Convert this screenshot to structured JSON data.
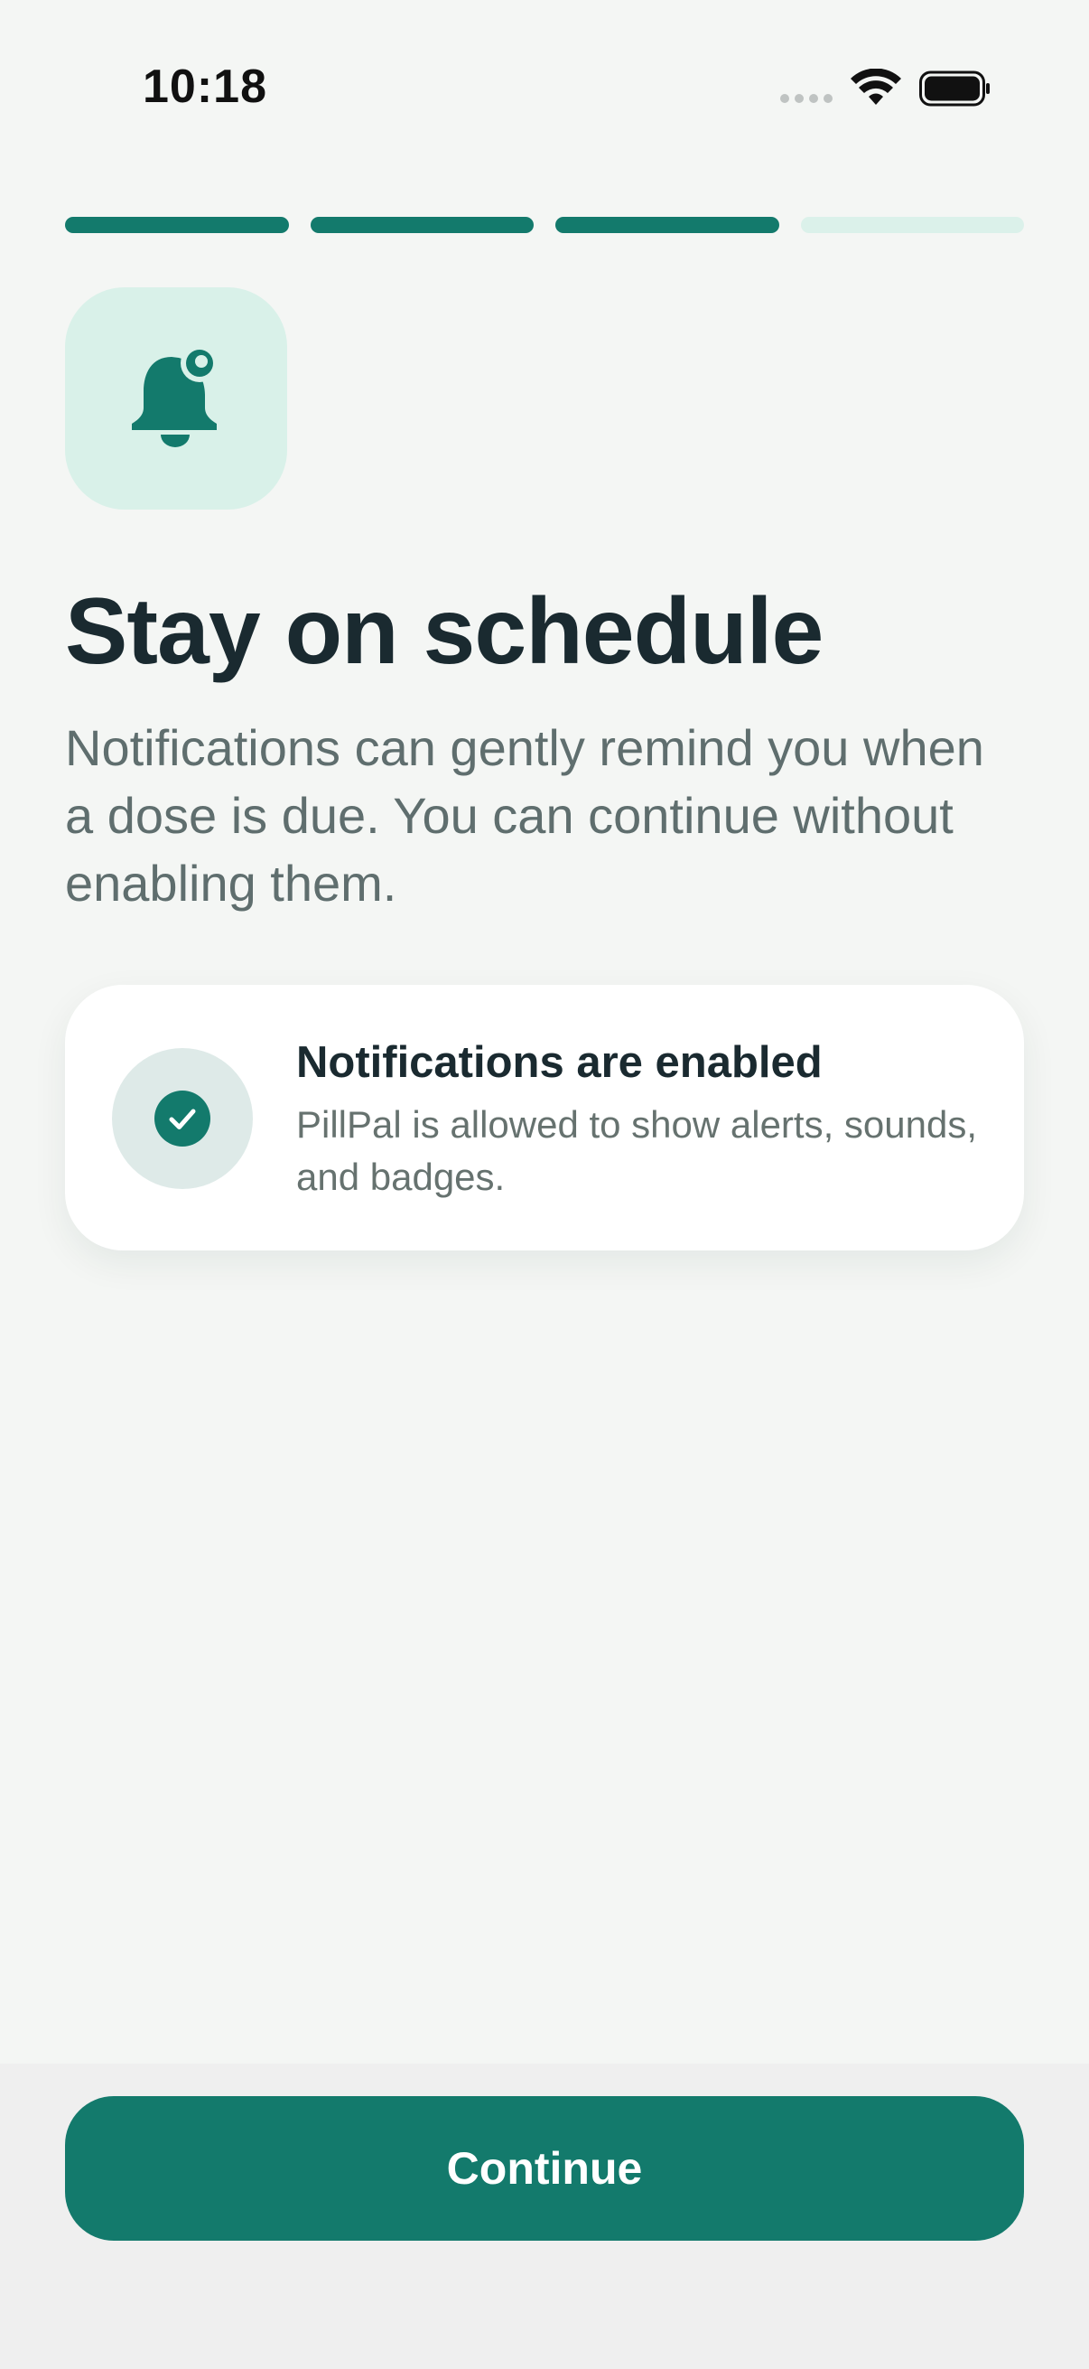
{
  "status_bar": {
    "time": "10:18"
  },
  "progress": {
    "total_steps": 4,
    "completed_steps": 3
  },
  "onboarding": {
    "icon": "bell-badge-icon",
    "title": "Stay on schedule",
    "description": "Notifications can gently remind you when a dose is due. You can continue without enabling them."
  },
  "status_card": {
    "icon": "checkmark-circle-icon",
    "title": "Notifications are enabled",
    "subtitle": "PillPal is allowed to show alerts, sounds, and badges."
  },
  "footer": {
    "continue_label": "Continue"
  },
  "colors": {
    "accent": "#137a6c",
    "accent_light": "#d9f1e9",
    "background": "#f4f6f4",
    "title": "#1a2a30",
    "muted_text": "#5f6e6e"
  }
}
